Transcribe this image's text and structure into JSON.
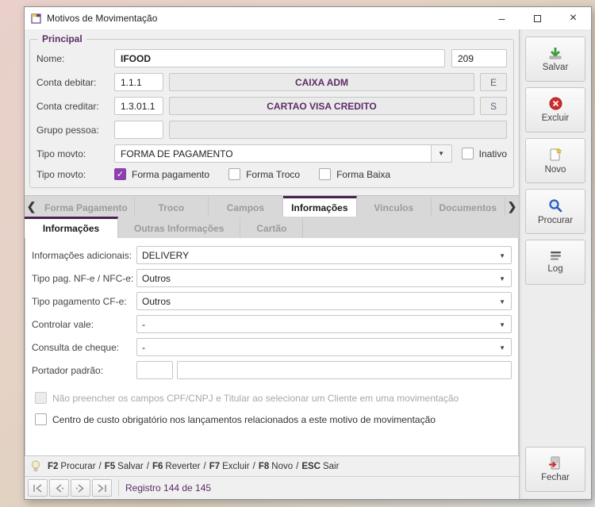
{
  "window": {
    "title": "Motivos de Movimentação",
    "controls": {
      "minimize": "–",
      "close": "×"
    }
  },
  "icons": {
    "dropdown": "▼",
    "check": "✓"
  },
  "principal": {
    "group_label": "Principal",
    "nome": {
      "label": "Nome:",
      "value": "IFOOD",
      "code": "209"
    },
    "conta_debitar": {
      "label": "Conta debitar:",
      "code": "1.1.1",
      "name": "CAIXA ADM",
      "button": "E"
    },
    "conta_creditar": {
      "label": "Conta creditar:",
      "code": "1.3.01.1",
      "name": "CARTAO VISA CREDITO",
      "button": "S"
    },
    "grupo_pessoa": {
      "label": "Grupo pessoa:",
      "code": "",
      "name": ""
    },
    "tipo_movto_select": {
      "label": "Tipo movto:",
      "value": "FORMA DE PAGAMENTO",
      "inativo_label": "Inativo",
      "inativo_checked": false
    },
    "tipo_movto_checks": {
      "label": "Tipo movto:",
      "options": [
        {
          "label": "Forma pagamento",
          "checked": true
        },
        {
          "label": "Forma Troco",
          "checked": false
        },
        {
          "label": "Forma Baixa",
          "checked": false
        }
      ]
    }
  },
  "tabs": {
    "main": [
      {
        "label": "Forma Pagamento",
        "active": false
      },
      {
        "label": "Troco",
        "active": false
      },
      {
        "label": "Campos",
        "active": false
      },
      {
        "label": "Informações",
        "active": true
      },
      {
        "label": "Vinculos",
        "active": false
      },
      {
        "label": "Documentos",
        "active": false
      }
    ],
    "sub": [
      {
        "label": "Informações",
        "active": true
      },
      {
        "label": "Outras Informações",
        "active": false
      },
      {
        "label": "Cartão",
        "active": false
      }
    ]
  },
  "form": {
    "fields": [
      {
        "label": "Informações adicionais:",
        "value": "DELIVERY"
      },
      {
        "label": "Tipo pag. NF-e / NFC-e:",
        "value": "Outros"
      },
      {
        "label": "Tipo pagamento CF-e:",
        "value": "Outros"
      },
      {
        "label": "Controlar vale:",
        "value": "-"
      },
      {
        "label": "Consulta de cheque:",
        "value": "-"
      }
    ],
    "portador": {
      "label": "Portador padrão:",
      "code": "",
      "name": ""
    },
    "checkboxes": [
      {
        "label": "Não preencher os campos CPF/CNPJ e Titular ao selecionar um Cliente em uma movimentação",
        "checked": false,
        "disabled": true
      },
      {
        "label": "Centro de custo obrigatório nos lançamentos relacionados a este motivo de movimentação",
        "checked": false,
        "disabled": false
      }
    ]
  },
  "statusbar": {
    "keys": [
      "F2",
      "F5",
      "F6",
      "F7",
      "F8",
      "ESC"
    ],
    "actions": [
      "Procurar",
      "Salvar",
      "Reverter",
      "Excluir",
      "Novo",
      "Sair"
    ],
    "sep": "/",
    "record": "Registro 144 de 145"
  },
  "sidebar": {
    "buttons": [
      {
        "label": "Salvar"
      },
      {
        "label": "Excluir"
      },
      {
        "label": "Novo"
      },
      {
        "label": "Procurar"
      },
      {
        "label": "Log"
      },
      {
        "label": "Fechar"
      }
    ]
  },
  "colors": {
    "accent_purple": "#5c2d66",
    "checkbox_purple": "#8e3fae",
    "tab_active_border": "#4a2150"
  }
}
